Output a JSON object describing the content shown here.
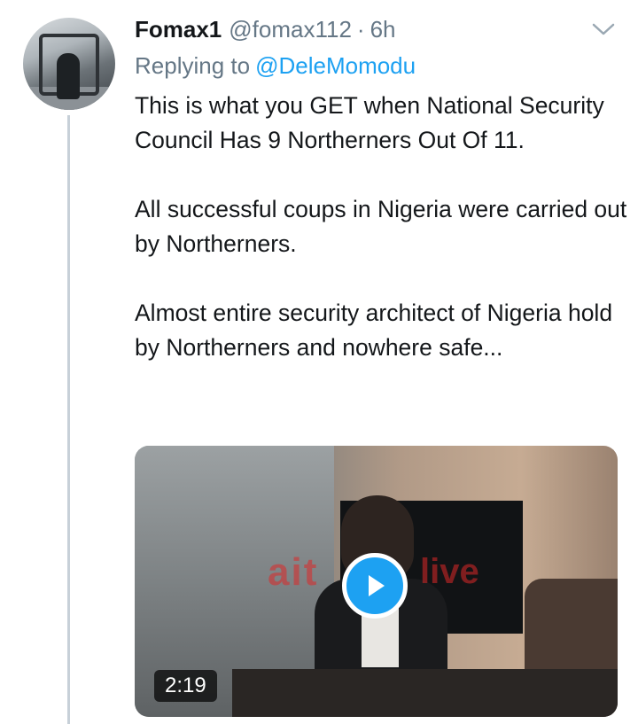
{
  "tweet": {
    "display_name": "Fomax1",
    "handle": "@fomax112",
    "separator": "·",
    "time": "6h",
    "reply_prefix": "Replying to",
    "reply_to": "@DeleMomodu",
    "paragraphs": [
      "This is what you GET when National Security Council Has 9 Northerners Out Of 11.",
      "All successful coups in Nigeria were carried out by Northerners.",
      "Almost entire security architect of Nigeria hold by Northerners and nowhere safe..."
    ]
  },
  "media": {
    "duration": "2:19",
    "watermark_left": "ait",
    "watermark_right": "live",
    "play_icon": "play-icon"
  },
  "icons": {
    "menu": "chevron-down-icon",
    "avatar": "avatar-image"
  },
  "colors": {
    "link": "#1da1f2",
    "muted": "#657786",
    "text": "#14171a",
    "thread_line": "#c7d0d8"
  }
}
